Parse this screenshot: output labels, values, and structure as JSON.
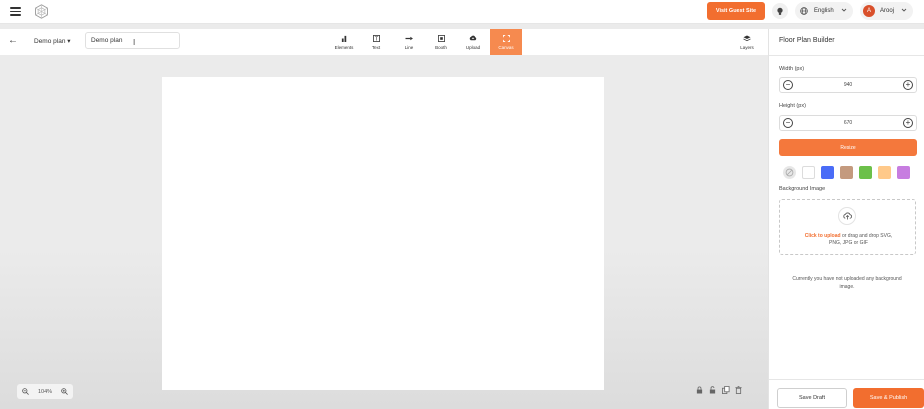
{
  "header": {
    "visit_button": "Visit Guest Site",
    "language": "English",
    "user_name": "Arooj",
    "user_initial": "A"
  },
  "toolbar": {
    "plan_dropdown": "Demo plan",
    "plan_name_value": "Demo plan",
    "tools": [
      "Elements",
      "Text",
      "Line",
      "Booth",
      "Upload",
      "Canvas"
    ],
    "active_tool": "Canvas",
    "layers": "Layers"
  },
  "canvas": {
    "zoom_level": "104%"
  },
  "panel": {
    "title": "Floor Plan Builder",
    "width_label": "Width (px)",
    "width_value": "940",
    "height_label": "Height (px)",
    "height_value": "670",
    "resize_button": "Resize",
    "swatches": [
      "#ffffff",
      "#4a6cf7",
      "#c49a7e",
      "#6cc04a",
      "#ffc98a",
      "#c77de0"
    ],
    "bg_image_label": "Background Image",
    "upload_link": "Click to upload",
    "upload_rest": " or drag and drop SVG,",
    "upload_formats": "PNG, JPG or GIF",
    "no_bg_text": "Currently you have not uploaded any background image.",
    "save_draft": "Save Draft",
    "publish": "Save & Publish"
  },
  "colors": {
    "accent": "#f26e2f",
    "active_tool": "#f68a4f"
  }
}
